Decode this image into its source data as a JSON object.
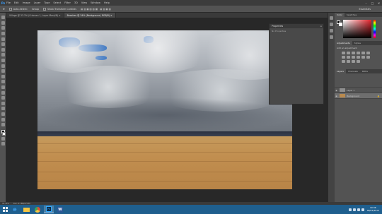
{
  "app": {
    "logo": "Ps",
    "menu": [
      "File",
      "Edit",
      "Image",
      "Layer",
      "Type",
      "Select",
      "Filter",
      "3D",
      "View",
      "Window",
      "Help"
    ],
    "window_buttons": [
      "–",
      "□",
      "✕"
    ]
  },
  "options_bar": {
    "items": [
      "Auto-Select:",
      "Group",
      "Show Transform Controls"
    ],
    "workspace": "Essentials"
  },
  "tabs": [
    {
      "label": "Village @ 33.3% (Crisman 1, Layer Mask/8) ×",
      "active": false
    },
    {
      "label": "Beaches @ 34% (Background, RGB/8) ×",
      "active": true
    }
  ],
  "properties_panel": {
    "title": "Properties",
    "body": "No Properties"
  },
  "right_panels": {
    "color_tabs": [
      "Color",
      "Swatches"
    ],
    "adjust_tabs": [
      "Adjustments",
      "Styles"
    ],
    "adjust_title": "Add an adjustment",
    "layer_tabs": [
      "Layers",
      "Channels",
      "Paths"
    ],
    "layers": [
      {
        "name": "Layer 1",
        "selected": false,
        "color": "#8e8e8e"
      },
      {
        "name": "Background",
        "selected": true,
        "color": "#b98a4e"
      }
    ]
  },
  "status": {
    "zoom": "33.33%",
    "doc": "Doc: 27.8M/27.8M"
  },
  "taskbar": {
    "apps": [
      {
        "icon": "ie-icon",
        "color": "#3c9be8",
        "glyph": "e",
        "active": false
      },
      {
        "icon": "folder-icon",
        "color": "#f5c542",
        "glyph": "▬",
        "active": false
      },
      {
        "icon": "chrome-icon",
        "color": "#e04b3c",
        "glyph": "●",
        "active": false
      },
      {
        "icon": "photoshop-icon",
        "color": "#0b2a47",
        "glyph": "Ps",
        "active": true
      },
      {
        "icon": "word-icon",
        "color": "#2b5797",
        "glyph": "W",
        "active": false
      }
    ],
    "time": "10:36",
    "date": "08/01/2015"
  }
}
